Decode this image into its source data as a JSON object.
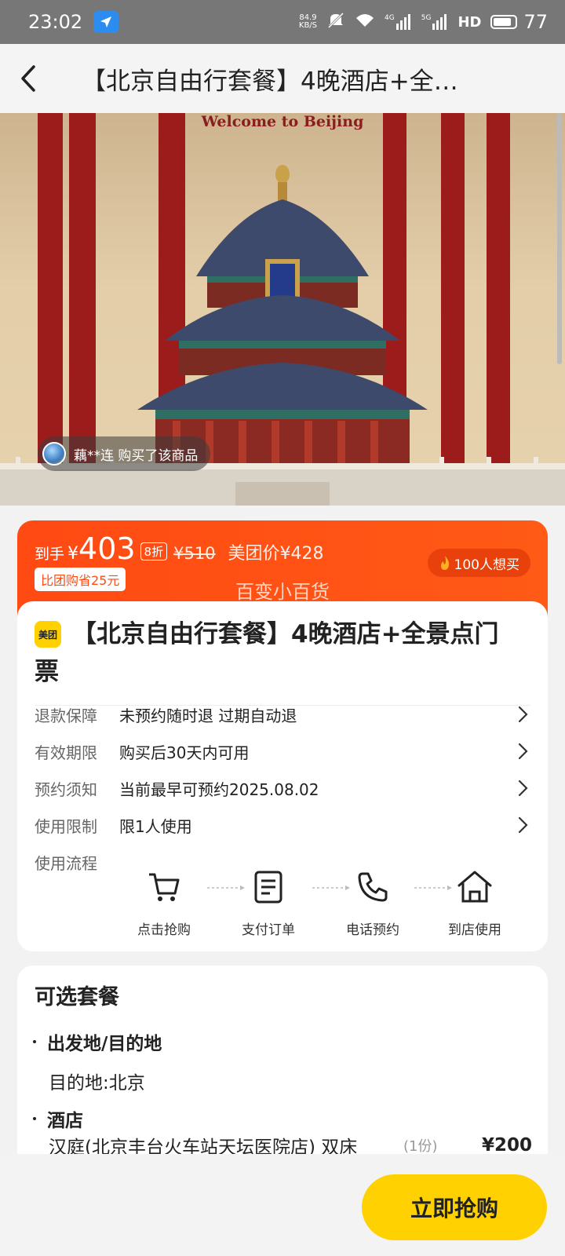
{
  "status_bar": {
    "time": "23:02",
    "net_speed_value": "84.9",
    "net_speed_unit": "KB/S",
    "signal_4g": "4G",
    "signal_5g": "5G",
    "hd": "HD",
    "battery": "77"
  },
  "header": {
    "title": "【北京自由行套餐】4晚酒店+全…"
  },
  "hero": {
    "welcome_text": "Welcome to Beijing",
    "buyer_notice": "藕**连 购买了该商品"
  },
  "price": {
    "label": "到手",
    "currency": "¥",
    "amount": "403",
    "discount": "8折",
    "original": "¥510",
    "meituan_price": "美团价¥428",
    "save_note": "比团购省25元",
    "want_count": "100人想买",
    "watermark": "百变小百货"
  },
  "product": {
    "logo_text": "美团",
    "title": "【北京自由行套餐】4晚酒店+全景点门票"
  },
  "info_rows": [
    {
      "label": "退款保障",
      "value": "未预约随时退 过期自动退"
    },
    {
      "label": "有效期限",
      "value": "购买后30天内可用"
    },
    {
      "label": "预约须知",
      "value": "当前最早可预约2025.08.02"
    },
    {
      "label": "使用限制",
      "value": "限1人使用"
    }
  ],
  "flow": {
    "label": "使用流程",
    "steps": [
      {
        "label": "点击抢购",
        "icon": "cart-icon"
      },
      {
        "label": "支付订单",
        "icon": "document-icon"
      },
      {
        "label": "电话预约",
        "icon": "phone-icon"
      },
      {
        "label": "到店使用",
        "icon": "house-icon"
      }
    ]
  },
  "packages": {
    "title": "可选套餐",
    "section_departure": "出发地/目的地",
    "destination": "目的地:北京",
    "section_hotel": "酒店",
    "hotel_name": "汉庭(北京丰台火车站天坛医院店) 双床",
    "hotel_qty": "(1份)",
    "hotel_price": "¥200"
  },
  "footer": {
    "buy_button": "立即抢购"
  },
  "colors": {
    "accent_orange": "#ff4a13",
    "button_yellow": "#ffd100",
    "pillar_red": "#9c1c1c"
  }
}
